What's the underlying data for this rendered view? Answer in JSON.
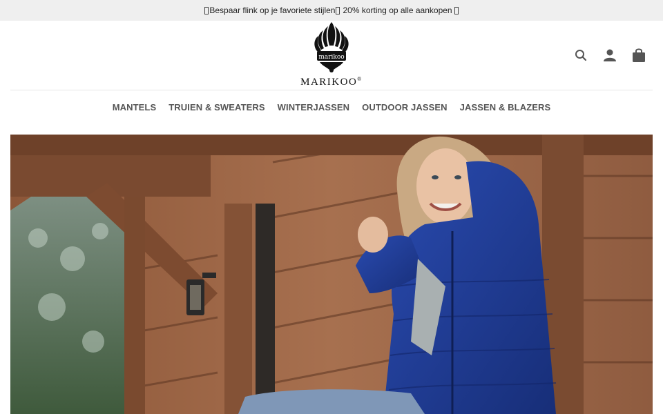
{
  "announcement": {
    "text": "Bespaar flink op je favoriete stijlen",
    "discount": "20% korting op alle aankopen"
  },
  "brand": {
    "name": "MARIKOO",
    "registered": "®"
  },
  "header_icons": [
    "search-icon",
    "account-icon",
    "cart-icon"
  ],
  "nav": {
    "items": [
      {
        "label": "MANTELS"
      },
      {
        "label": "TRUIEN & SWEATERS"
      },
      {
        "label": "WINTERJASSEN"
      },
      {
        "label": "OUTDOOR JASSEN"
      },
      {
        "label": "JASSEN & BLAZERS"
      }
    ]
  },
  "hero": {
    "subject": "woman in blue puffer jacket on wooden cabin porch"
  },
  "colors": {
    "topbar_bg": "#efefef",
    "nav_text": "#555555",
    "jacket_blue": "#1f3b8f",
    "wood": "#9a6444"
  }
}
